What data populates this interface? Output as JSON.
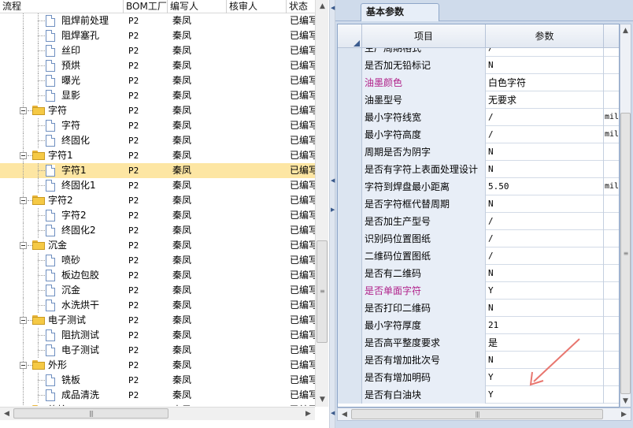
{
  "left": {
    "columns": {
      "flow": "流程",
      "bom_factory": "BOM工厂",
      "writer": "编写人",
      "reviewer": "核审人",
      "status": "状态"
    },
    "rows": [
      {
        "level": 2,
        "type": "item",
        "label": "阻焊前处理",
        "bom": "P2",
        "writer": "秦凤",
        "reviewer": "",
        "status": "已编写",
        "selected": false
      },
      {
        "level": 2,
        "type": "item",
        "label": "阻焊塞孔",
        "bom": "P2",
        "writer": "秦凤",
        "reviewer": "",
        "status": "已编写",
        "selected": false
      },
      {
        "level": 2,
        "type": "item",
        "label": "丝印",
        "bom": "P2",
        "writer": "秦凤",
        "reviewer": "",
        "status": "已编写",
        "selected": false
      },
      {
        "level": 2,
        "type": "item",
        "label": "预烘",
        "bom": "P2",
        "writer": "秦凤",
        "reviewer": "",
        "status": "已编写",
        "selected": false
      },
      {
        "level": 2,
        "type": "item",
        "label": "曝光",
        "bom": "P2",
        "writer": "秦凤",
        "reviewer": "",
        "status": "已编写",
        "selected": false
      },
      {
        "level": 2,
        "type": "item",
        "label": "显影",
        "bom": "P2",
        "writer": "秦凤",
        "reviewer": "",
        "status": "已编写",
        "selected": false
      },
      {
        "level": 1,
        "type": "folder",
        "label": "字符",
        "bom": "P2",
        "writer": "秦凤",
        "reviewer": "",
        "status": "已编写",
        "selected": false
      },
      {
        "level": 2,
        "type": "item",
        "label": "字符",
        "bom": "P2",
        "writer": "秦凤",
        "reviewer": "",
        "status": "已编写",
        "selected": false
      },
      {
        "level": 2,
        "type": "item",
        "label": "终固化",
        "bom": "P2",
        "writer": "秦凤",
        "reviewer": "",
        "status": "已编写",
        "selected": false
      },
      {
        "level": 1,
        "type": "folder",
        "label": "字符1",
        "bom": "P2",
        "writer": "秦凤",
        "reviewer": "",
        "status": "已编写",
        "selected": false
      },
      {
        "level": 2,
        "type": "item",
        "label": "字符1",
        "bom": "P2",
        "writer": "秦凤",
        "reviewer": "",
        "status": "已编写",
        "selected": true
      },
      {
        "level": 2,
        "type": "item",
        "label": "终固化1",
        "bom": "P2",
        "writer": "秦凤",
        "reviewer": "",
        "status": "已编写",
        "selected": false
      },
      {
        "level": 1,
        "type": "folder",
        "label": "字符2",
        "bom": "P2",
        "writer": "秦凤",
        "reviewer": "",
        "status": "已编写",
        "selected": false
      },
      {
        "level": 2,
        "type": "item",
        "label": "字符2",
        "bom": "P2",
        "writer": "秦凤",
        "reviewer": "",
        "status": "已编写",
        "selected": false
      },
      {
        "level": 2,
        "type": "item",
        "label": "终固化2",
        "bom": "P2",
        "writer": "秦凤",
        "reviewer": "",
        "status": "已编写",
        "selected": false
      },
      {
        "level": 1,
        "type": "folder",
        "label": "沉金",
        "bom": "P2",
        "writer": "秦凤",
        "reviewer": "",
        "status": "已编写",
        "selected": false
      },
      {
        "level": 2,
        "type": "item",
        "label": "喷砂",
        "bom": "P2",
        "writer": "秦凤",
        "reviewer": "",
        "status": "已编写",
        "selected": false
      },
      {
        "level": 2,
        "type": "item",
        "label": "板边包胶",
        "bom": "P2",
        "writer": "秦凤",
        "reviewer": "",
        "status": "已编写",
        "selected": false
      },
      {
        "level": 2,
        "type": "item",
        "label": "沉金",
        "bom": "P2",
        "writer": "秦凤",
        "reviewer": "",
        "status": "已编写",
        "selected": false
      },
      {
        "level": 2,
        "type": "item",
        "label": "水洗烘干",
        "bom": "P2",
        "writer": "秦凤",
        "reviewer": "",
        "status": "已编写",
        "selected": false
      },
      {
        "level": 1,
        "type": "folder",
        "label": "电子测试",
        "bom": "P2",
        "writer": "秦凤",
        "reviewer": "",
        "status": "已编写",
        "selected": false
      },
      {
        "level": 2,
        "type": "item",
        "label": "阻抗测试",
        "bom": "P2",
        "writer": "秦凤",
        "reviewer": "",
        "status": "已编写",
        "selected": false
      },
      {
        "level": 2,
        "type": "item",
        "label": "电子测试",
        "bom": "P2",
        "writer": "秦凤",
        "reviewer": "",
        "status": "已编写",
        "selected": false
      },
      {
        "level": 1,
        "type": "folder",
        "label": "外形",
        "bom": "P2",
        "writer": "秦凤",
        "reviewer": "",
        "status": "已编写",
        "selected": false
      },
      {
        "level": 2,
        "type": "item",
        "label": "铣板",
        "bom": "P2",
        "writer": "秦凤",
        "reviewer": "",
        "status": "已编写",
        "selected": false
      },
      {
        "level": 2,
        "type": "item",
        "label": "成品清洗",
        "bom": "P2",
        "writer": "秦凤",
        "reviewer": "",
        "status": "已编写",
        "selected": false
      },
      {
        "level": 1,
        "type": "folder",
        "label": "终检",
        "bom": "P2",
        "writer": "秦凤",
        "reviewer": "",
        "status": "已编写",
        "selected": false
      }
    ]
  },
  "right": {
    "tab": "基本参数",
    "columns": {
      "item": "项目",
      "param": "参数"
    },
    "rows": [
      {
        "key": "生产周期格式",
        "value": "/",
        "unit": "",
        "highlight": false,
        "mono": true
      },
      {
        "key": "是否加无铅标记",
        "value": "N",
        "unit": "",
        "highlight": false,
        "mono": true
      },
      {
        "key": "油墨颜色",
        "value": "白色字符",
        "unit": "",
        "highlight": true,
        "mono": false
      },
      {
        "key": "油墨型号",
        "value": "无要求",
        "unit": "",
        "highlight": false,
        "mono": false
      },
      {
        "key": "最小字符线宽",
        "value": "/",
        "unit": "mil",
        "highlight": false,
        "mono": true
      },
      {
        "key": "最小字符高度",
        "value": "/",
        "unit": "mil",
        "highlight": false,
        "mono": true
      },
      {
        "key": "周期是否为阴字",
        "value": "N",
        "unit": "",
        "highlight": false,
        "mono": true
      },
      {
        "key": "是否有字符上表面处理设计",
        "value": "N",
        "unit": "",
        "highlight": false,
        "mono": true
      },
      {
        "key": "字符到焊盘最小距离",
        "value": "5.50",
        "unit": "mil",
        "highlight": false,
        "mono": true
      },
      {
        "key": "是否字符框代替周期",
        "value": "N",
        "unit": "",
        "highlight": false,
        "mono": true
      },
      {
        "key": "是否加生产型号",
        "value": "/",
        "unit": "",
        "highlight": false,
        "mono": true
      },
      {
        "key": "识别码位置图纸",
        "value": "/",
        "unit": "",
        "highlight": false,
        "mono": true
      },
      {
        "key": "二维码位置图纸",
        "value": "/",
        "unit": "",
        "highlight": false,
        "mono": true
      },
      {
        "key": "是否有二维码",
        "value": "N",
        "unit": "",
        "highlight": false,
        "mono": true
      },
      {
        "key": "是否单面字符",
        "value": "Y",
        "unit": "",
        "highlight": true,
        "mono": true
      },
      {
        "key": "是否打印二维码",
        "value": "N",
        "unit": "",
        "highlight": false,
        "mono": true
      },
      {
        "key": "最小字符厚度",
        "value": "21",
        "unit": "",
        "highlight": false,
        "mono": true
      },
      {
        "key": "是否高平整度要求",
        "value": "是",
        "unit": "",
        "highlight": false,
        "mono": false
      },
      {
        "key": "是否有增加批次号",
        "value": "N",
        "unit": "",
        "highlight": false,
        "mono": true
      },
      {
        "key": "是否有增加明码",
        "value": "Y",
        "unit": "",
        "highlight": false,
        "mono": true
      },
      {
        "key": "是否有白油块",
        "value": "Y",
        "unit": "",
        "highlight": false,
        "mono": true
      }
    ]
  },
  "colors": {
    "selected_row": "#fde6a3",
    "highlight_key": "#b0218a",
    "annotation_arrow": "#e8766f"
  },
  "icons": {
    "folder": "folder-icon",
    "item": "document-icon",
    "expander": "collapse-icon"
  }
}
